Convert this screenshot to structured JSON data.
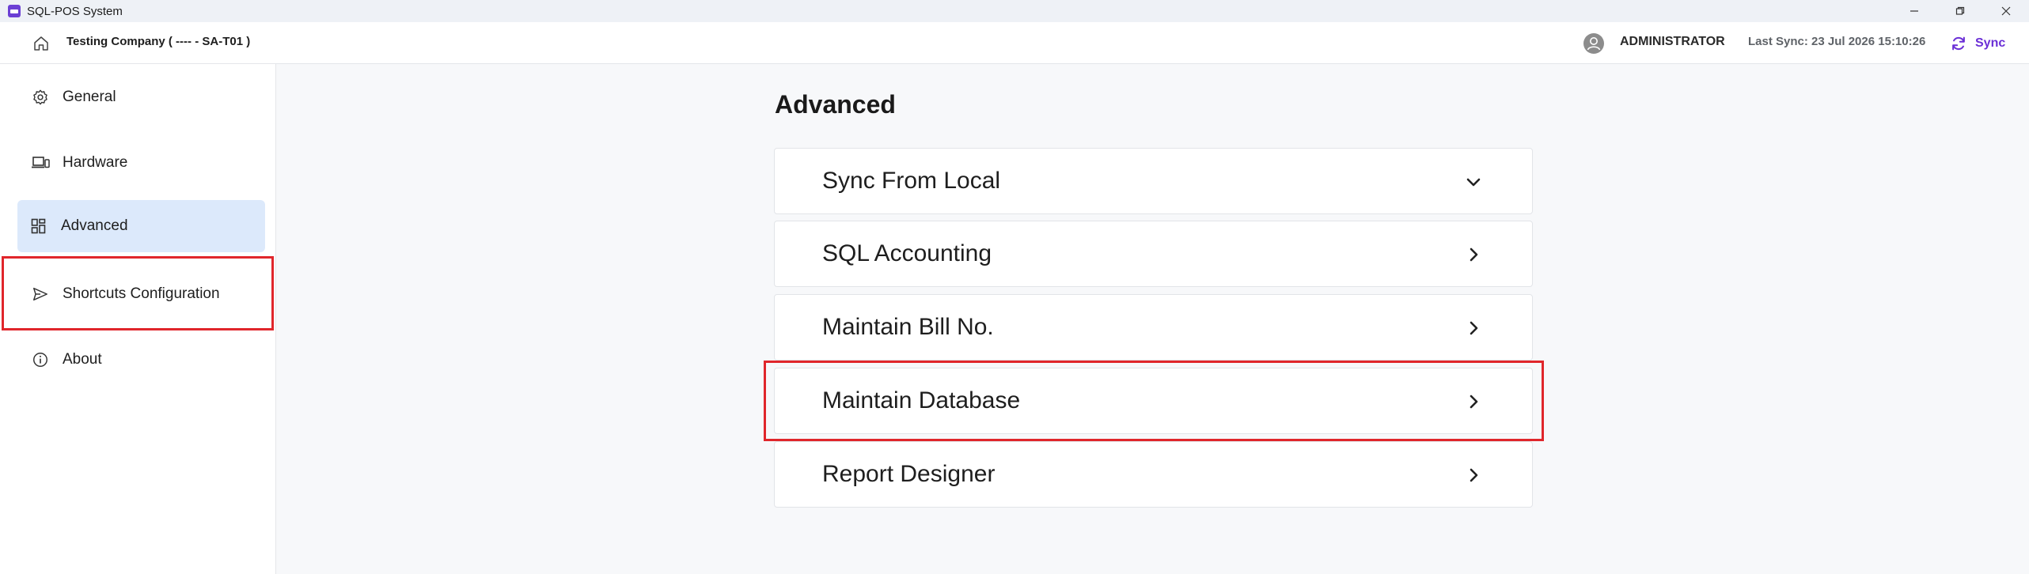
{
  "window": {
    "title": "SQL-POS System",
    "controls": [
      "minimize-icon",
      "restore-icon",
      "close-icon"
    ]
  },
  "header": {
    "company": "Testing Company ( ---- - SA-T01 )",
    "user": "ADMINISTRATOR",
    "last_sync": "Last Sync: 23 Jul 2026 15:10:26",
    "sync_label": "Sync"
  },
  "sidebar": {
    "items": [
      {
        "label": "General",
        "icon": "gear-icon",
        "active": false
      },
      {
        "label": "Hardware",
        "icon": "devices-icon",
        "active": false
      },
      {
        "label": "Advanced",
        "icon": "dashboard-icon",
        "active": true
      },
      {
        "label": "Shortcuts Configuration",
        "icon": "send-icon",
        "active": false
      },
      {
        "label": "About",
        "icon": "info-icon",
        "active": false
      }
    ]
  },
  "main": {
    "title": "Advanced",
    "sections": [
      {
        "label": "Sync From Local",
        "icon": "chevron-down-icon"
      },
      {
        "label": "SQL Accounting",
        "icon": "chevron-right-icon"
      },
      {
        "label": "Maintain Bill No.",
        "icon": "chevron-right-icon"
      },
      {
        "label": "Maintain Database",
        "icon": "chevron-right-icon"
      },
      {
        "label": "Report Designer",
        "icon": "chevron-right-icon"
      }
    ]
  },
  "colors": {
    "accent": "#6b2fd6",
    "active_nav_bg": "#dce9fb",
    "highlight": "#e0262b",
    "background": "#f7f8fa"
  }
}
